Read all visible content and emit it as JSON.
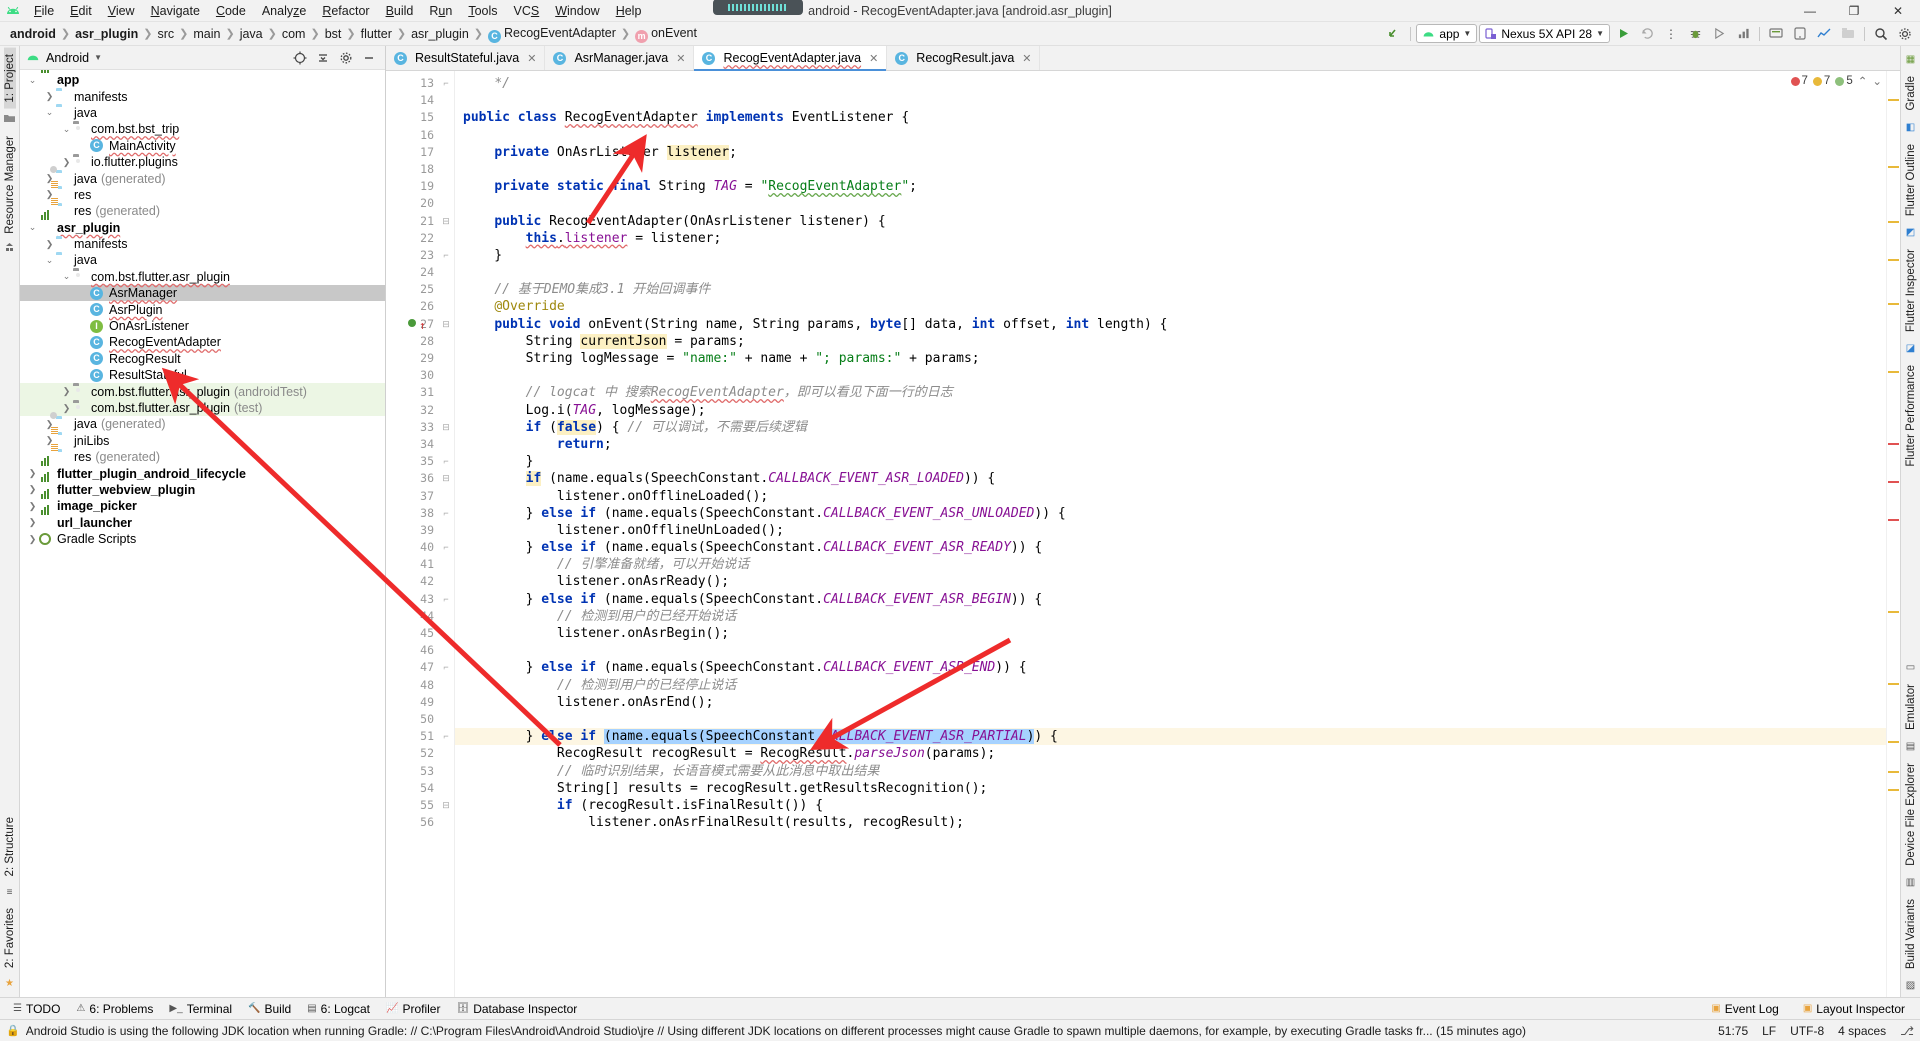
{
  "window": {
    "title": "android - RecogEventAdapter.java [android.asr_plugin]",
    "minimize": "—",
    "maximize": "❐",
    "close": "✕"
  },
  "menubar": [
    {
      "label": "File",
      "mnemonic": "F"
    },
    {
      "label": "Edit",
      "mnemonic": "E"
    },
    {
      "label": "View",
      "mnemonic": "V"
    },
    {
      "label": "Navigate",
      "mnemonic": "N"
    },
    {
      "label": "Code",
      "mnemonic": "C"
    },
    {
      "label": "Analyze",
      "mnemonic": "z"
    },
    {
      "label": "Refactor",
      "mnemonic": "R"
    },
    {
      "label": "Build",
      "mnemonic": "B"
    },
    {
      "label": "Run",
      "mnemonic": "u"
    },
    {
      "label": "Tools",
      "mnemonic": "T"
    },
    {
      "label": "VCS",
      "mnemonic": "S"
    },
    {
      "label": "Window",
      "mnemonic": "W"
    },
    {
      "label": "Help",
      "mnemonic": "H"
    }
  ],
  "breadcrumb": [
    {
      "label": "android",
      "bold": true,
      "icon": null
    },
    {
      "label": "asr_plugin",
      "bold": true,
      "icon": null,
      "wavy": true
    },
    {
      "label": "src",
      "bold": false,
      "icon": null,
      "wavy": true
    },
    {
      "label": "main",
      "bold": false,
      "icon": null,
      "wavy": true
    },
    {
      "label": "java",
      "bold": false,
      "icon": null,
      "wavy": true
    },
    {
      "label": "com",
      "bold": false,
      "icon": null,
      "wavy": true
    },
    {
      "label": "bst",
      "bold": false,
      "icon": null,
      "wavy": true
    },
    {
      "label": "flutter",
      "bold": false,
      "icon": null,
      "wavy": true
    },
    {
      "label": "asr_plugin",
      "bold": false,
      "icon": null,
      "wavy": true
    },
    {
      "label": "RecogEventAdapter",
      "bold": false,
      "icon": "class",
      "wavy": true
    },
    {
      "label": "onEvent",
      "bold": false,
      "icon": "method",
      "wavy": true
    }
  ],
  "toolbar": {
    "build_icon": "hammer-icon",
    "module_selector": "app",
    "device_selector": "Nexus 5X API 28",
    "run_icon": "run-icon",
    "debug_icon": "debug-icon",
    "more_icon": "more-vertical-icon",
    "search_icon": "search-icon",
    "settings_icon": "gear-icon"
  },
  "left_rail": [
    {
      "label": "1: Project",
      "selected": true
    },
    {
      "label": "Resource Manager",
      "selected": false
    },
    {
      "label": "2: Structure",
      "selected": false
    },
    {
      "label": "2: Favorites",
      "selected": false
    }
  ],
  "right_rail": [
    {
      "label": "Gradle"
    },
    {
      "label": "Flutter Outline"
    },
    {
      "label": "Flutter Inspector"
    },
    {
      "label": "Flutter Performance"
    },
    {
      "label": "Emulator"
    },
    {
      "label": "Device File Explorer"
    },
    {
      "label": "Build Variants"
    },
    {
      "label": "Layout Inspector"
    }
  ],
  "project_panel": {
    "title": "Android",
    "header_icons": [
      "target-icon",
      "collapse-all-icon",
      "gear-icon",
      "hide-icon"
    ],
    "tree": [
      {
        "depth": 0,
        "arrow": "down",
        "icon": "module",
        "label": "app",
        "bold": true
      },
      {
        "depth": 1,
        "arrow": "right",
        "icon": "folder",
        "label": "manifests"
      },
      {
        "depth": 1,
        "arrow": "down",
        "icon": "folder",
        "label": "java"
      },
      {
        "depth": 2,
        "arrow": "down",
        "icon": "package",
        "label": "com.bst.bst_trip",
        "wavy": true
      },
      {
        "depth": 3,
        "arrow": "none",
        "icon": "class",
        "label": "MainActivity",
        "wavy": true
      },
      {
        "depth": 2,
        "arrow": "right",
        "icon": "package",
        "label": "io.flutter.plugins"
      },
      {
        "depth": 1,
        "arrow": "right",
        "icon": "folder-gen",
        "label": "java",
        "suffix": "(generated)"
      },
      {
        "depth": 1,
        "arrow": "right",
        "icon": "folder-res",
        "label": "res"
      },
      {
        "depth": 1,
        "arrow": "none",
        "icon": "folder-res",
        "label": "res",
        "suffix": "(generated)"
      },
      {
        "depth": 0,
        "arrow": "down",
        "icon": "module",
        "label": "asr_plugin",
        "bold": true,
        "wavy": true
      },
      {
        "depth": 1,
        "arrow": "right",
        "icon": "folder",
        "label": "manifests"
      },
      {
        "depth": 1,
        "arrow": "down",
        "icon": "folder",
        "label": "java"
      },
      {
        "depth": 2,
        "arrow": "down",
        "icon": "package",
        "label": "com.bst.flutter.asr_plugin",
        "wavy": true
      },
      {
        "depth": 3,
        "arrow": "none",
        "icon": "class",
        "label": "AsrManager",
        "selected": true,
        "wavy": true
      },
      {
        "depth": 3,
        "arrow": "none",
        "icon": "class",
        "label": "AsrPlugin",
        "wavy": true
      },
      {
        "depth": 3,
        "arrow": "none",
        "icon": "interface",
        "label": "OnAsrListener"
      },
      {
        "depth": 3,
        "arrow": "none",
        "icon": "class",
        "label": "RecogEventAdapter",
        "wavy": true
      },
      {
        "depth": 3,
        "arrow": "none",
        "icon": "class",
        "label": "RecogResult"
      },
      {
        "depth": 3,
        "arrow": "none",
        "icon": "class",
        "label": "ResultStateful"
      },
      {
        "depth": 2,
        "arrow": "right",
        "icon": "package",
        "label": "com.bst.flutter.asr_plugin",
        "suffix": "(androidTest)",
        "test": true
      },
      {
        "depth": 2,
        "arrow": "right",
        "icon": "package",
        "label": "com.bst.flutter.asr_plugin",
        "suffix": "(test)",
        "test": true
      },
      {
        "depth": 1,
        "arrow": "right",
        "icon": "folder-gen",
        "label": "java",
        "suffix": "(generated)"
      },
      {
        "depth": 1,
        "arrow": "right",
        "icon": "folder-res",
        "label": "jniLibs"
      },
      {
        "depth": 1,
        "arrow": "none",
        "icon": "folder-res",
        "label": "res",
        "suffix": "(generated)"
      },
      {
        "depth": 0,
        "arrow": "right",
        "icon": "module",
        "label": "flutter_plugin_android_lifecycle",
        "bold": true
      },
      {
        "depth": 0,
        "arrow": "right",
        "icon": "module",
        "label": "flutter_webview_plugin",
        "bold": true
      },
      {
        "depth": 0,
        "arrow": "right",
        "icon": "module",
        "label": "image_picker",
        "bold": true
      },
      {
        "depth": 0,
        "arrow": "right",
        "icon": "module",
        "label": "url_launcher",
        "bold": true
      },
      {
        "depth": 0,
        "arrow": "right",
        "icon": "gradle",
        "label": "Gradle Scripts"
      }
    ]
  },
  "editor_tabs": [
    {
      "label": "ResultStateful.java",
      "icon": "class",
      "active": false
    },
    {
      "label": "AsrManager.java",
      "icon": "class",
      "active": false
    },
    {
      "label": "RecogEventAdapter.java",
      "icon": "class",
      "active": true,
      "wavy": true
    },
    {
      "label": "RecogResult.java",
      "icon": "class",
      "active": false
    }
  ],
  "inspection": {
    "errors": "7",
    "warnings": "7",
    "weak": "5",
    "error_icon": "error-icon",
    "warning_icon": "warning-icon",
    "weak-warning-icon": "weak-warning-icon",
    "up_icon": "chevron-up-icon",
    "down_icon": "chevron-down-icon"
  },
  "code": {
    "first_line": 13,
    "lines": [
      {
        "n": 13,
        "fold": "end",
        "html": "    <span class=\"cmt\">*/</span>"
      },
      {
        "n": 14,
        "html": ""
      },
      {
        "n": 15,
        "html": "<span class=\"kw\">public class</span> <span class=\"wv\">RecogEventAdapter</span> <span class=\"kw\">implements</span> EventListener {"
      },
      {
        "n": 16,
        "html": ""
      },
      {
        "n": 17,
        "html": "    <span class=\"kw\">private</span> OnAsrListener <span class=\"hlbox\">listener</span>;"
      },
      {
        "n": 18,
        "html": ""
      },
      {
        "n": 19,
        "html": "    <span class=\"kw\">private static final</span> String <span class=\"sfld\">TAG</span> = <span class=\"str\">\"<span class=\"grn\">RecogEventAdapter</span>\"</span>;"
      },
      {
        "n": 20,
        "html": ""
      },
      {
        "n": 21,
        "fold": "start",
        "html": "    <span class=\"kw\">public</span> RecogEventAdapter(OnAsrListener listener) {"
      },
      {
        "n": 22,
        "html": "        <span class=\"kw wv\">this</span><span class=\"wv\">.</span><span class=\"fld wv\">listener</span> = listener;"
      },
      {
        "n": 23,
        "fold": "end",
        "html": "    }"
      },
      {
        "n": 24,
        "html": ""
      },
      {
        "n": 25,
        "html": "    <span class=\"cmt\">// 基于DEMO集成3.1 开始回调事件</span>"
      },
      {
        "n": 26,
        "html": "    <span class=\"ann\">@Override</span>"
      },
      {
        "n": 27,
        "gutterIcon": true,
        "fold": "start",
        "html": "    <span class=\"kw\">public void</span> onEvent(String name, String params, <span class=\"kw\">byte</span>[] data, <span class=\"kw\">int</span> offset, <span class=\"kw\">int</span> length) {"
      },
      {
        "n": 28,
        "html": "        String <span class=\"hlbox\">currentJson</span> = params;"
      },
      {
        "n": 29,
        "html": "        String logMessage = <span class=\"str\">\"name:\"</span> + name + <span class=\"str\">\"; params:\"</span> + params;"
      },
      {
        "n": 30,
        "html": ""
      },
      {
        "n": 31,
        "html": "        <span class=\"cmt\">// logcat 中 搜索<span class=\"wv\">RecogEventAdapter</span>，即可以看见下面一行的日志</span>"
      },
      {
        "n": 32,
        "html": "        Log.i(<span class=\"sfld\">TAG</span>, logMessage);"
      },
      {
        "n": 33,
        "fold": "start",
        "html": "        <span class=\"kw\">if</span> (<span class=\"kw hlbox\">false</span>) { <span class=\"cmt\">// 可以调试，不需要后续逻辑</span>"
      },
      {
        "n": 34,
        "html": "            <span class=\"kw\">return</span>;"
      },
      {
        "n": 35,
        "fold": "end",
        "html": "        }"
      },
      {
        "n": 36,
        "fold": "start",
        "html": "        <span class=\"kw hlbox\">if</span> (name.equals(SpeechConstant.<span class=\"sfld\">CALLBACK_EVENT_ASR_LOADED</span>)) {"
      },
      {
        "n": 37,
        "html": "            listener.onOfflineLoaded();"
      },
      {
        "n": 38,
        "fold": "end",
        "html": "        } <span class=\"kw\">else if</span> (name.equals(SpeechConstant.<span class=\"sfld\">CALLBACK_EVENT_ASR_UNLOADED</span>)) {"
      },
      {
        "n": 39,
        "html": "            listener.onOfflineUnLoaded();"
      },
      {
        "n": 40,
        "fold": "end",
        "html": "        } <span class=\"kw\">else if</span> (name.equals(SpeechConstant.<span class=\"sfld\">CALLBACK_EVENT_ASR_READY</span>)) {"
      },
      {
        "n": 41,
        "html": "            <span class=\"cmt\">// 引擎准备就绪，可以开始说话</span>"
      },
      {
        "n": 42,
        "html": "            listener.onAsrReady();"
      },
      {
        "n": 43,
        "fold": "end",
        "html": "        } <span class=\"kw\">else if</span> (name.equals(SpeechConstant.<span class=\"sfld\">CALLBACK_EVENT_ASR_BEGIN</span>)) {"
      },
      {
        "n": 44,
        "html": "            <span class=\"cmt\">// 检测到用户的已经开始说话</span>"
      },
      {
        "n": 45,
        "html": "            listener.onAsrBegin();"
      },
      {
        "n": 46,
        "html": ""
      },
      {
        "n": 47,
        "fold": "end",
        "html": "        } <span class=\"kw\">else if</span> (name.equals(SpeechConstant.<span class=\"sfld\">CALLBACK_EVENT_ASR_END</span>)) {"
      },
      {
        "n": 48,
        "html": "            <span class=\"cmt\">// 检测到用户的已经停止说话</span>"
      },
      {
        "n": 49,
        "html": "            listener.onAsrEnd();"
      },
      {
        "n": 50,
        "html": ""
      },
      {
        "n": 51,
        "hl": true,
        "fold": "end",
        "html": "        } <span class=\"kw\">else if</span> <span class=\"sel\">(name.equals(SpeechConstant.<span class=\"sfld\">CALLBACK_EVENT_ASR_PARTIAL</span>)</span>) {"
      },
      {
        "n": 52,
        "html": "            RecogResult recogResult = <span class=\"wv\">RecogResult</span>.<span class=\"sfld\">parseJson</span>(params);"
      },
      {
        "n": 53,
        "html": "            <span class=\"cmt\">// 临时识别结果，长语音模式需要从此消息中取出结果</span>"
      },
      {
        "n": 54,
        "html": "            String[] results = recogResult.getResultsRecognition();"
      },
      {
        "n": 55,
        "fold": "start",
        "html": "            <span class=\"kw\">if</span> (recogResult.isFinalResult()) {"
      },
      {
        "n": 56,
        "html": "                listener.onAsrFinalResult(results, recogResult);"
      }
    ]
  },
  "bottom_toolwindows": [
    {
      "label": "TODO",
      "icon": "todo-icon"
    },
    {
      "label": "6: Problems",
      "icon": "problems-icon"
    },
    {
      "label": "Terminal",
      "icon": "terminal-icon"
    },
    {
      "label": "Build",
      "icon": "build-icon"
    },
    {
      "label": "6: Logcat",
      "icon": "logcat-icon"
    },
    {
      "label": "Profiler",
      "icon": "profiler-icon"
    },
    {
      "label": "Database Inspector",
      "icon": "database-icon"
    }
  ],
  "bottom_right_toolwindows": [
    {
      "label": "Event Log",
      "icon": "event-log-icon"
    },
    {
      "label": "Layout Inspector",
      "icon": "layout-inspector-icon"
    }
  ],
  "statusbar": {
    "lock_icon": "lock-icon",
    "message": "Android Studio is using the following JDK location when running Gradle: // C:\\Program Files\\Android\\Android Studio\\jre // Using different JDK locations on different processes might cause Gradle to spawn multiple daemons, for example, by executing Gradle tasks fr... (15 minutes ago)",
    "caret": "51:75",
    "line_sep": "LF",
    "encoding": "UTF-8",
    "indent": "4 spaces",
    "branch_icon": "branch-icon"
  }
}
